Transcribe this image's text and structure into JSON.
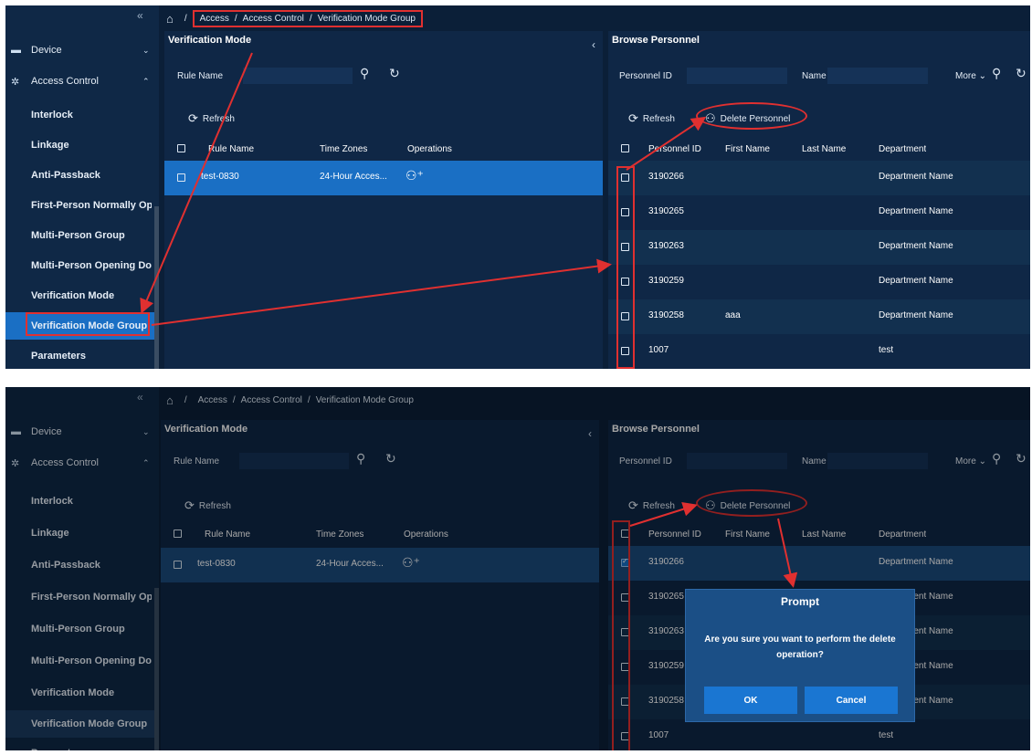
{
  "breadcrumb": {
    "items": [
      "Access",
      "Access Control",
      "Verification Mode Group"
    ]
  },
  "sidebar": {
    "groups": [
      {
        "label": "Device",
        "icon": "device-icon"
      },
      {
        "label": "Access Control",
        "icon": "gear-icon"
      }
    ],
    "items": [
      {
        "label": "Interlock"
      },
      {
        "label": "Linkage"
      },
      {
        "label": "Anti-Passback"
      },
      {
        "label": "First-Person Normally Open"
      },
      {
        "label": "Multi-Person Group"
      },
      {
        "label": "Multi-Person Opening Door"
      },
      {
        "label": "Verification Mode"
      },
      {
        "label": "Verification Mode Group",
        "active": true
      },
      {
        "label": "Parameters"
      }
    ]
  },
  "left_panel": {
    "title": "Verification Mode",
    "rule_name_label": "Rule Name",
    "refresh_label": "Refresh",
    "columns": [
      "Rule Name",
      "Time Zones",
      "Operations"
    ],
    "rows": [
      {
        "rule_name": "test-0830",
        "time_zones": "24-Hour Acces..."
      }
    ]
  },
  "right_panel": {
    "title": "Browse Personnel",
    "personnel_id_label": "Personnel ID",
    "name_label": "Name",
    "more_label": "More",
    "refresh_label": "Refresh",
    "delete_label": "Delete Personnel",
    "columns": [
      "Personnel ID",
      "First Name",
      "Last Name",
      "Department"
    ],
    "rows": [
      {
        "id": "3190266",
        "first": "",
        "last": "",
        "dept": "Department Name"
      },
      {
        "id": "3190265",
        "first": "",
        "last": "",
        "dept": "Department Name"
      },
      {
        "id": "3190263",
        "first": "",
        "last": "",
        "dept": "Department Name"
      },
      {
        "id": "3190259",
        "first": "",
        "last": "",
        "dept": "Department Name"
      },
      {
        "id": "3190258",
        "first": "aaa",
        "last": "",
        "dept": "Department Name"
      },
      {
        "id": "1007",
        "first": "",
        "last": "",
        "dept": "test"
      }
    ]
  },
  "dialog": {
    "title": "Prompt",
    "message": "Are you sure you want to perform the delete operation?",
    "ok_label": "OK",
    "cancel_label": "Cancel"
  },
  "colors": {
    "background": "#0b1f38",
    "panel": "#0f2746",
    "accent": "#1a6fc4",
    "annotation": "#e03030"
  }
}
